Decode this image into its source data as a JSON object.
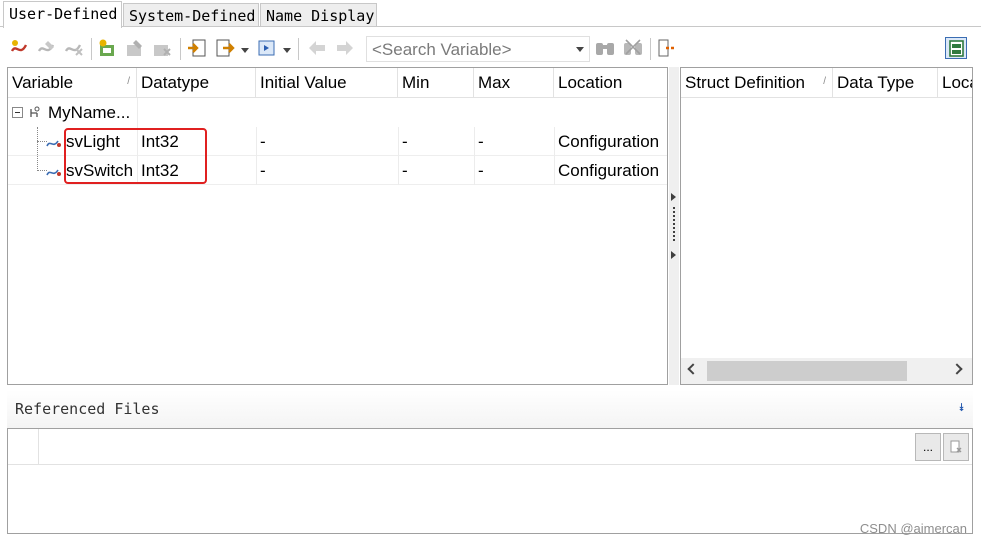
{
  "tabs": [
    {
      "label": "User-Defined",
      "active": true
    },
    {
      "label": "System-Defined",
      "active": false
    },
    {
      "label": "Name Display",
      "active": false
    }
  ],
  "toolbar": {
    "search_placeholder": "<Search Variable>",
    "icons": [
      "add-variable-icon",
      "edit-variable-icon",
      "delete-variable-icon",
      "add-namespace-icon",
      "edit-namespace-icon",
      "delete-namespace-icon",
      "import-icon",
      "export-icon",
      "deploy-icon",
      "undo-icon",
      "redo-icon",
      "find-icon",
      "find-next-icon",
      "open-location-icon",
      "layout-toggle-icon"
    ]
  },
  "variables_table": {
    "columns": [
      "Variable",
      "Datatype",
      "Initial Value",
      "Min",
      "Max",
      "Location"
    ],
    "namespace": "MyName...",
    "rows": [
      {
        "variable": "svLight",
        "datatype": "Int32",
        "initial": "-",
        "min": "-",
        "max": "-",
        "location": "Configuration"
      },
      {
        "variable": "svSwitch",
        "datatype": "Int32",
        "initial": "-",
        "min": "-",
        "max": "-",
        "location": "Configuration"
      }
    ]
  },
  "struct_table": {
    "columns": [
      "Struct Definition",
      "Data Type",
      "Loca"
    ]
  },
  "referenced_files": {
    "title": "Referenced Files",
    "browse_label": "..."
  },
  "watermark": "CSDN @aimercan",
  "colors": {
    "highlight": "#e02020",
    "accent": "#2a5db0"
  }
}
